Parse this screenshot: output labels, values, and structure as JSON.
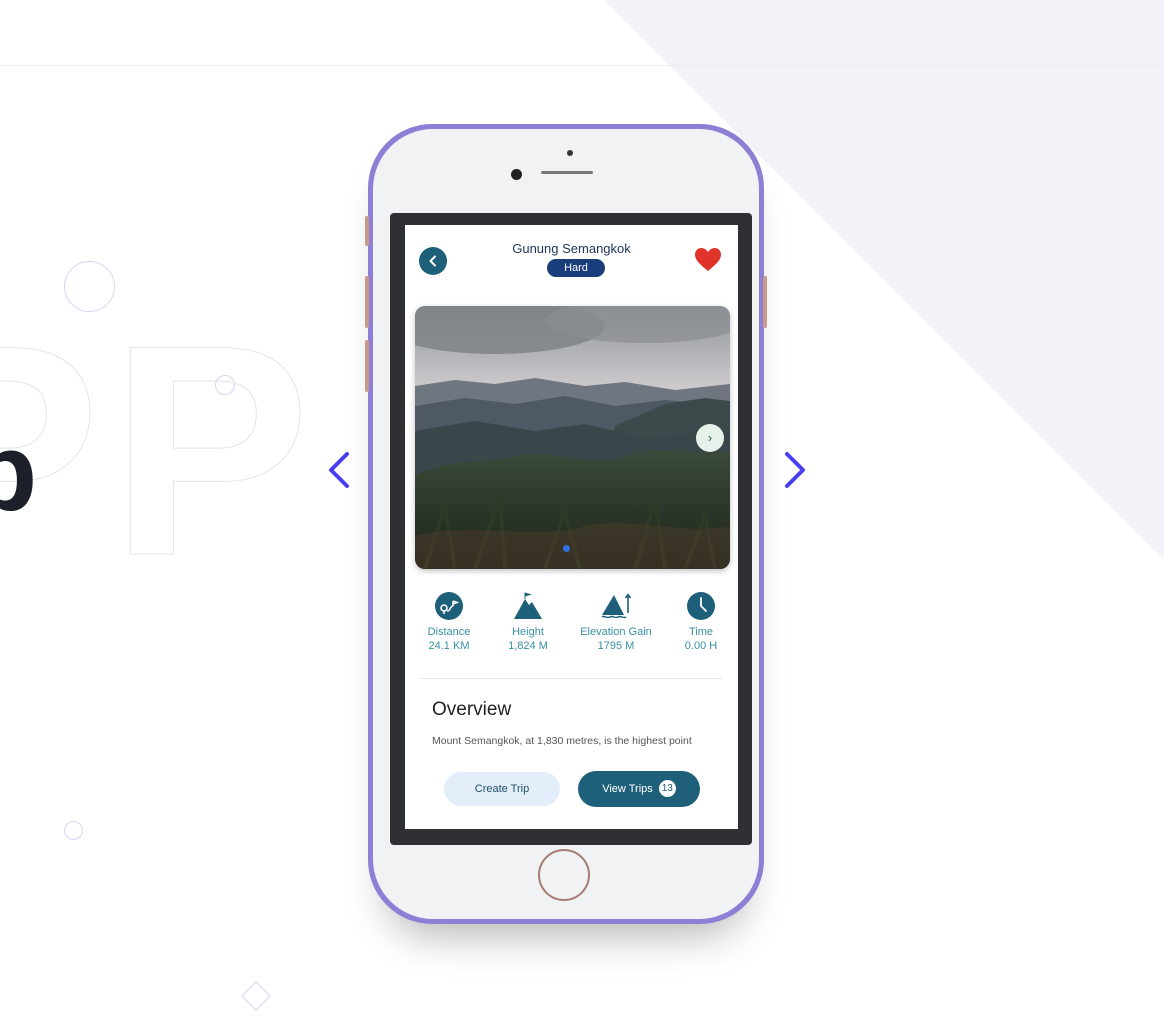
{
  "app": {
    "title": "Gunung Semangkok",
    "difficulty": "Hard"
  },
  "decor": {
    "solid_letter": "p",
    "outline_letters": "PP"
  },
  "stats": [
    {
      "icon": "distance-icon",
      "label": "Distance",
      "value": "24.1 KM"
    },
    {
      "icon": "mountain-icon",
      "label": "Height",
      "value": "1,824 M"
    },
    {
      "icon": "elevation-icon",
      "label": "Elevation Gain",
      "value": "1795 M"
    },
    {
      "icon": "clock-icon",
      "label": "Time",
      "value": "0.00 H"
    }
  ],
  "overview": {
    "heading": "Overview",
    "text": "Mount Semangkok, at 1,830 metres, is the highest point"
  },
  "actions": {
    "create_trip": "Create Trip",
    "view_trips": "View Trips",
    "trip_count": "13"
  },
  "colors": {
    "accent": "#1e6079",
    "badge": "#1a3d7c",
    "heart": "#e0332b",
    "phone_frame": "#8f7ed6",
    "nav_arrow": "#4a3ff0"
  }
}
